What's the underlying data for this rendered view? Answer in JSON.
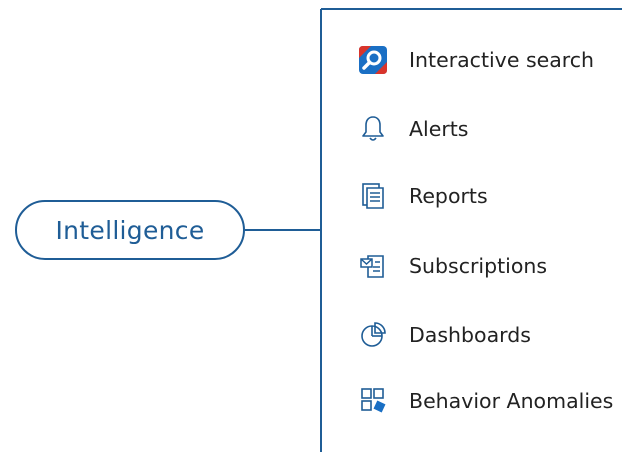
{
  "diagram": {
    "root": {
      "label": "Intelligence"
    },
    "items": [
      {
        "label": "Interactive search",
        "icon": "interactive-search-icon"
      },
      {
        "label": "Alerts",
        "icon": "bell-icon"
      },
      {
        "label": "Reports",
        "icon": "report-document-icon"
      },
      {
        "label": "Subscriptions",
        "icon": "subscription-mail-icon"
      },
      {
        "label": "Dashboards",
        "icon": "pie-chart-icon"
      },
      {
        "label": "Behavior Anomalies",
        "icon": "anomaly-grid-icon"
      }
    ]
  },
  "colors": {
    "line": "#1f5d96",
    "accent_blue": "#1a6fc4",
    "accent_red": "#d9342b",
    "text": "#222222"
  }
}
